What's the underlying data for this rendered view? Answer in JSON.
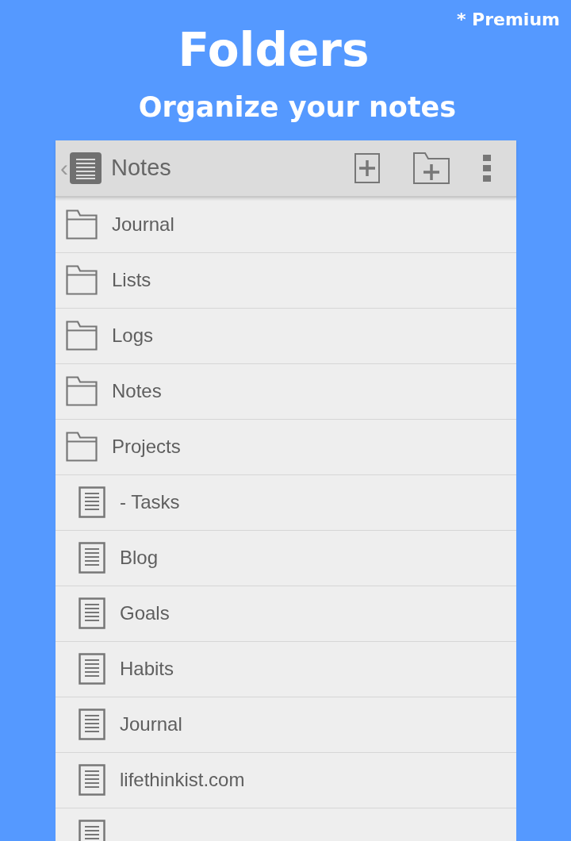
{
  "badge": "* Premium",
  "title": "Folders",
  "subtitle": "Organize your notes",
  "app_bar": {
    "back": "‹",
    "title": "Notes"
  },
  "items": [
    {
      "kind": "folder",
      "label": "Journal"
    },
    {
      "kind": "folder",
      "label": "Lists"
    },
    {
      "kind": "folder",
      "label": "Logs"
    },
    {
      "kind": "folder",
      "label": "Notes"
    },
    {
      "kind": "folder",
      "label": "Projects"
    },
    {
      "kind": "note",
      "label": "- Tasks"
    },
    {
      "kind": "note",
      "label": "Blog"
    },
    {
      "kind": "note",
      "label": "Goals"
    },
    {
      "kind": "note",
      "label": "Habits"
    },
    {
      "kind": "note",
      "label": "Journal"
    },
    {
      "kind": "note",
      "label": "lifethinkist.com"
    },
    {
      "kind": "note"
    }
  ]
}
